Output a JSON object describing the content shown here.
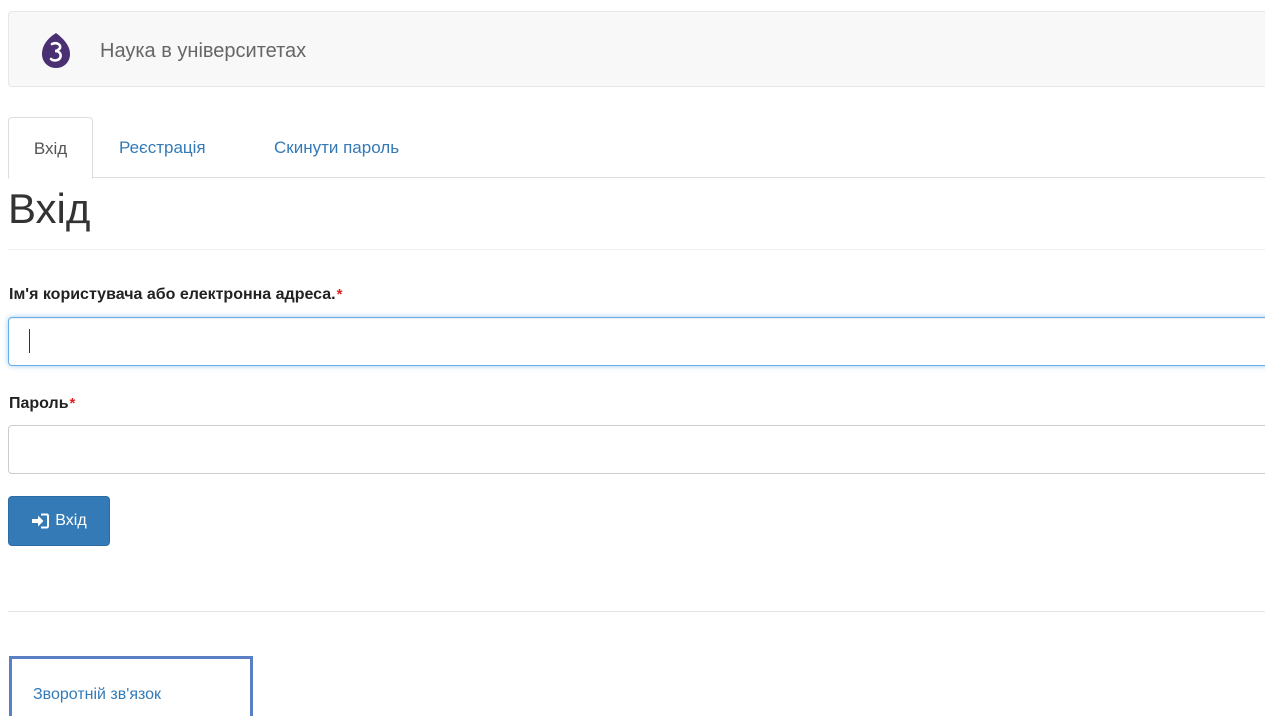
{
  "navbar": {
    "brand_title": "Наука в університетах",
    "logo_icon": "university-logo-icon",
    "logo_color": "#4a2f73"
  },
  "tabs": [
    {
      "label": "Вхід",
      "active": true
    },
    {
      "label": "Реєстрація",
      "active": false
    },
    {
      "label": "Скинути пароль",
      "active": false
    }
  ],
  "page": {
    "title": "Вхід"
  },
  "form": {
    "username_label": "Ім'я користувача або електронна адреса.",
    "username_value": "",
    "password_label": "Пароль",
    "password_value": "",
    "required_mark": "*",
    "submit_label": "Вхід",
    "submit_icon": "sign-in-icon"
  },
  "footer": {
    "feedback_label": "Зворотній зв'язок"
  },
  "colors": {
    "accent": "#337ab7",
    "required": "#e02020",
    "highlight_border": "#5b7fc4"
  }
}
